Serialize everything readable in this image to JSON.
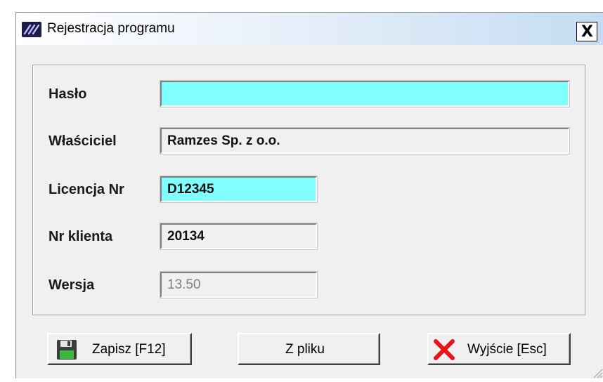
{
  "window": {
    "title": "Rejestracja programu",
    "close_label": "X"
  },
  "form": {
    "password": {
      "label": "Hasło",
      "value": ""
    },
    "owner": {
      "label": "Właściciel",
      "value": "Ramzes Sp. z o.o."
    },
    "license": {
      "label": "Licencja Nr",
      "value": "D12345"
    },
    "client": {
      "label": "Nr klienta",
      "value": "20134"
    },
    "version": {
      "label": "Wersja",
      "value": "13.50"
    }
  },
  "buttons": {
    "save": "Zapisz  [F12]",
    "from_file": "Z pliku",
    "exit": "Wyjście  [Esc]"
  },
  "colors": {
    "input_highlight": "#80ffff",
    "title_gradient_end": "#c5dcf2",
    "exit_icon": "#e8141c",
    "save_icon_green": "#3cb83c"
  },
  "icons": {
    "app": "app-logo-icon",
    "save": "floppy-disk-icon",
    "exit": "red-x-icon"
  }
}
